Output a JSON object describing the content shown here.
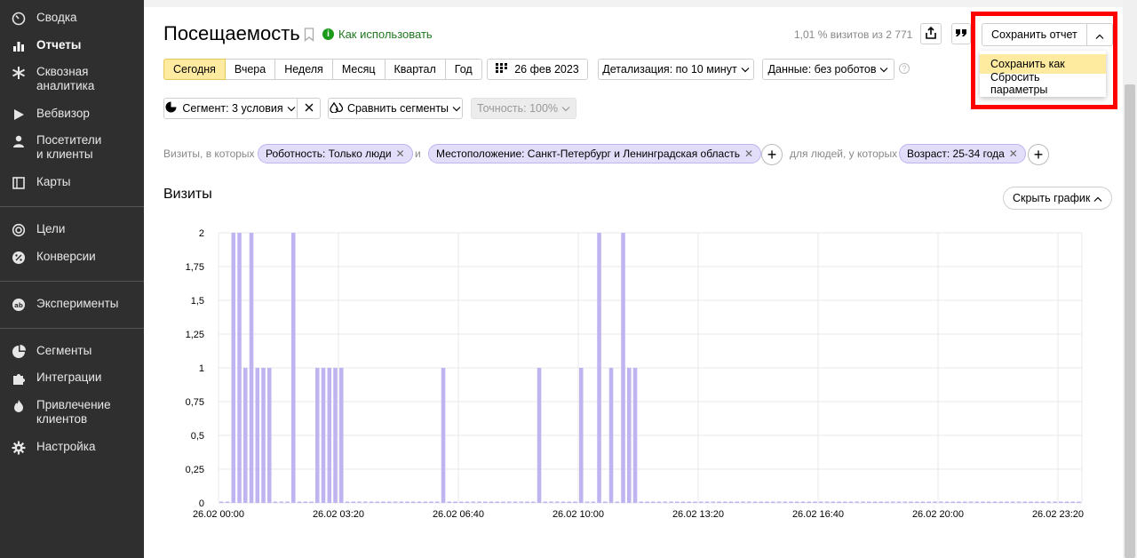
{
  "sidebar": {
    "items": [
      {
        "label": "Сводка",
        "icon": "gauge-icon"
      },
      {
        "label": "Отчеты",
        "icon": "bar-chart-icon",
        "active": true
      },
      {
        "label": "Сквозная\nаналитика",
        "icon": "asterisk-icon"
      },
      {
        "label": "Вебвизор",
        "icon": "play-icon"
      },
      {
        "label": "Посетители\nи клиенты",
        "icon": "person-icon"
      },
      {
        "label": "Карты",
        "icon": "map-icon"
      },
      {
        "label": "Цели",
        "icon": "target-icon"
      },
      {
        "label": "Конверсии",
        "icon": "percent-icon"
      },
      {
        "label": "Эксперименты",
        "icon": "ab-icon"
      },
      {
        "label": "Сегменты",
        "icon": "pie-icon"
      },
      {
        "label": "Интеграции",
        "icon": "puzzle-icon"
      },
      {
        "label": "Привлечение\nклиентов",
        "icon": "flame-icon"
      },
      {
        "label": "Настройка",
        "icon": "gear-icon"
      }
    ]
  },
  "header": {
    "title": "Посещаемость",
    "howto": "Как использовать",
    "visits_share": "1,01 % визитов из 2 771",
    "save_report": "Сохранить отчет",
    "save_menu": [
      "Сохранить как",
      "Сбросить параметры"
    ]
  },
  "period": {
    "options": [
      "Сегодня",
      "Вчера",
      "Неделя",
      "Месяц",
      "Квартал",
      "Год"
    ],
    "selected": "Сегодня",
    "date": "26 фев 2023",
    "detail": "Детализация: по 10 минут",
    "data": "Данные: без роботов"
  },
  "segment": {
    "segment_label": "Сегмент: 3 условия",
    "compare": "Сравнить сегменты",
    "accuracy": "Точность: 100%"
  },
  "filters": {
    "visits_label": "Визиты, в которых",
    "chip1": "Роботность: Только люди",
    "and": "и",
    "chip2": "Местоположение: Санкт-Петербург и Ленинградская область",
    "people_label": "для людей, у которых",
    "chip3": "Возраст: 25-34 года"
  },
  "chart_section": {
    "title": "Визиты",
    "hide_chart": "Скрыть график"
  },
  "chart_data": {
    "type": "bar",
    "title": "",
    "xlabel": "",
    "ylabel": "",
    "ylim": [
      0,
      2
    ],
    "y_ticks": [
      "0",
      "0,25",
      "0,5",
      "0,75",
      "1",
      "1,25",
      "1,5",
      "1,75",
      "2"
    ],
    "x_ticks": [
      "26.02 00:00",
      "26.02 03:20",
      "26.02 06:40",
      "26.02 10:00",
      "26.02 13:20",
      "26.02 16:40",
      "26.02 20:00",
      "26.02 23:20"
    ],
    "interval_minutes": 10,
    "bar_color": "#bfb4f0",
    "values": [
      0,
      0,
      2,
      2,
      1,
      2,
      1,
      1,
      1,
      0,
      0,
      0,
      2,
      0,
      0,
      0,
      1,
      1,
      1,
      1,
      1,
      0,
      0,
      0,
      0,
      0,
      0,
      0,
      0,
      0,
      0,
      0,
      0,
      0,
      0,
      0,
      0,
      1,
      0,
      0,
      0,
      0,
      0,
      0,
      0,
      0,
      0,
      0,
      0,
      0,
      0,
      0,
      0,
      1,
      0,
      0,
      0,
      0,
      0,
      0,
      1,
      0,
      0,
      2,
      0,
      1,
      0,
      2,
      1,
      1,
      0,
      0,
      0,
      0,
      0,
      0,
      0,
      0,
      0,
      0,
      0,
      0,
      0,
      0,
      0,
      0,
      0,
      0,
      0,
      0,
      0,
      0,
      0,
      0,
      0,
      0,
      0,
      0,
      0,
      0,
      0,
      0,
      0,
      0,
      0,
      0,
      0,
      0,
      0,
      0,
      0,
      0,
      0,
      0,
      0,
      0,
      0,
      0,
      0,
      0,
      0,
      0,
      0,
      0,
      0,
      0,
      0,
      0,
      0,
      0,
      0,
      0,
      0,
      0,
      0,
      0,
      0,
      0,
      0,
      0,
      0,
      0,
      0,
      0
    ]
  }
}
